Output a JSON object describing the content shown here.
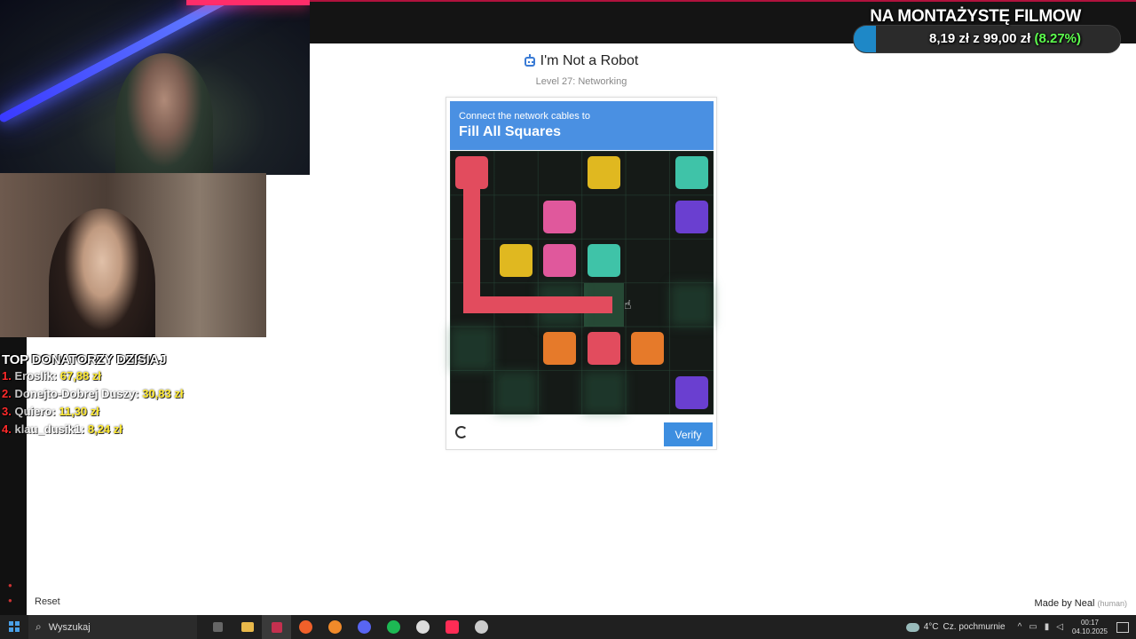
{
  "stream": {
    "goal_title": "NA MONTAŻYSTĘ FILMOW",
    "goal_current": "8,19 zł",
    "goal_sep": "z",
    "goal_total": "99,00 zł",
    "goal_percent_label": "(8.27%)",
    "goal_fraction": 0.0827,
    "donors_title": "TOP DONATORZY DZISIAJ",
    "donors": [
      {
        "num": "1.",
        "name": "Eroslik:",
        "amount": "67,88 zł"
      },
      {
        "num": "2.",
        "name": "Donejto-Dobrej Duszy:",
        "amount": "30,83 zł"
      },
      {
        "num": "3.",
        "name": "Quiero:",
        "amount": "11,30 zł"
      },
      {
        "num": "4.",
        "name": "klau_dusik1:",
        "amount": "8,24 zł"
      }
    ]
  },
  "captcha": {
    "title": "I'm Not a Robot",
    "level": "Level 27: Networking",
    "instruction_small": "Connect the network cables to",
    "instruction_big": "Fill All Squares",
    "verify_label": "Verify",
    "colors": {
      "banner": "#4a90e2",
      "red": "#e24c5e",
      "yellow": "#e0b820",
      "teal": "#3fc3a8",
      "purple": "#6a3fd0",
      "pink": "#e0589c",
      "orange": "#e67a2a"
    },
    "grid_size": 6,
    "tiles": [
      {
        "row": 0,
        "col": 0,
        "color": "red"
      },
      {
        "row": 0,
        "col": 3,
        "color": "yellow"
      },
      {
        "row": 0,
        "col": 5,
        "color": "teal"
      },
      {
        "row": 1,
        "col": 2,
        "color": "pink"
      },
      {
        "row": 1,
        "col": 5,
        "color": "purple"
      },
      {
        "row": 2,
        "col": 1,
        "color": "yellow"
      },
      {
        "row": 2,
        "col": 2,
        "color": "pink"
      },
      {
        "row": 2,
        "col": 3,
        "color": "teal"
      },
      {
        "row": 4,
        "col": 2,
        "color": "orange"
      },
      {
        "row": 4,
        "col": 3,
        "color": "red"
      },
      {
        "row": 4,
        "col": 4,
        "color": "orange"
      },
      {
        "row": 5,
        "col": 5,
        "color": "purple"
      }
    ],
    "cable_path": [
      [
        0,
        0
      ],
      [
        1,
        0
      ],
      [
        2,
        0
      ],
      [
        3,
        0
      ],
      [
        3,
        1
      ],
      [
        3,
        2
      ],
      [
        3,
        3
      ]
    ]
  },
  "page": {
    "reset_label": "Reset",
    "made_by": "Made by Neal",
    "made_by_tag": "(human)"
  },
  "taskbar": {
    "search_placeholder": "Wyszukaj",
    "weather_temp": "4°C",
    "weather_desc": "Cz. pochmurnie",
    "time": "00:17",
    "date": "04.10.2025"
  }
}
